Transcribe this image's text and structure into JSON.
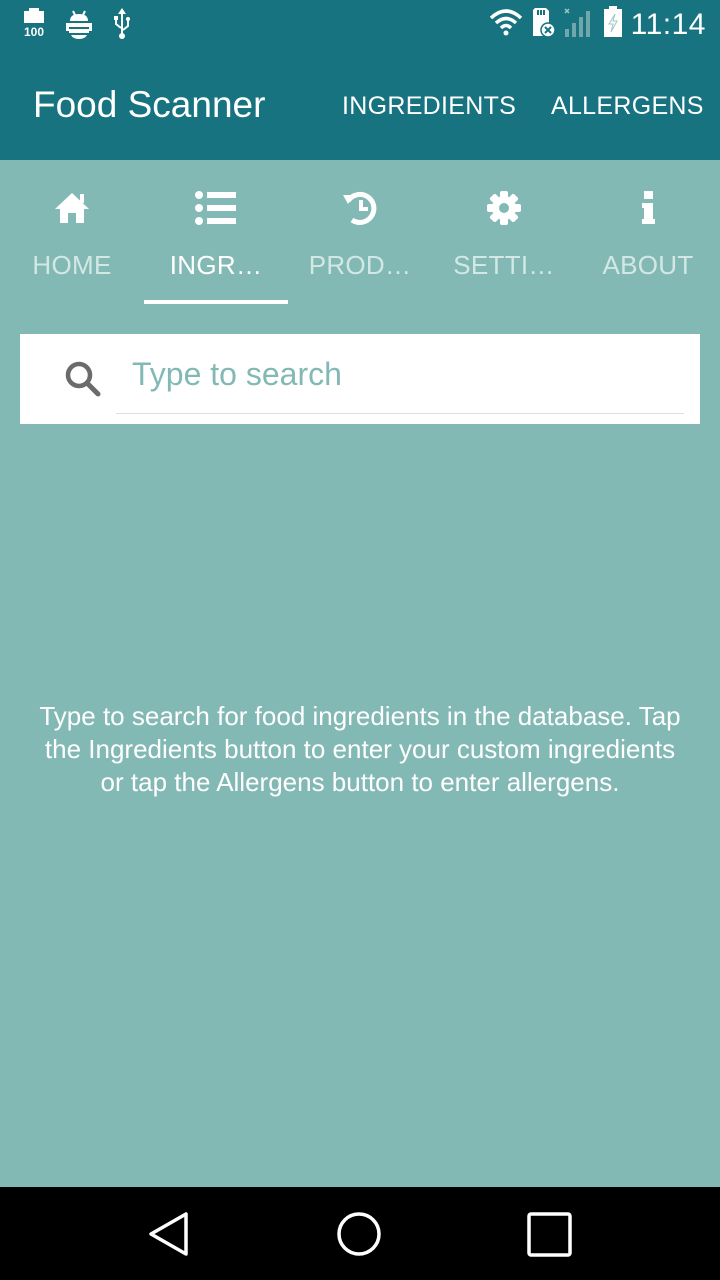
{
  "status_bar": {
    "left_icons": [
      "battery-100-icon",
      "android-debug-icon",
      "usb-icon"
    ],
    "right_icons": [
      "wifi-icon",
      "sd-card-error-icon",
      "signal-no-service-icon",
      "battery-charging-icon"
    ],
    "time": "11:14"
  },
  "app_bar": {
    "title": "Food Scanner",
    "actions": [
      {
        "label": "INGREDIENTS"
      },
      {
        "label": "ALLERGENS"
      }
    ]
  },
  "tabs": [
    {
      "label": "HOME",
      "icon": "home-icon",
      "active": false
    },
    {
      "label": "INGR…",
      "icon": "list-icon",
      "active": true
    },
    {
      "label": "PROD…",
      "icon": "history-icon",
      "active": false
    },
    {
      "label": "SETTI…",
      "icon": "gear-icon",
      "active": false
    },
    {
      "label": "ABOUT",
      "icon": "info-icon",
      "active": false
    }
  ],
  "search": {
    "placeholder": "Type to search",
    "value": ""
  },
  "hint_text": "Type to search for food ingredients in the database. Tap the Ingredients button to enter your custom ingredients or tap the Allergens button to enter allergens.",
  "nav_bar": {
    "buttons": [
      "back",
      "home",
      "recents"
    ]
  },
  "colors": {
    "primary": "#16737f",
    "background": "#83b9b4",
    "inactive_tab_text": "#d3e8e5"
  }
}
